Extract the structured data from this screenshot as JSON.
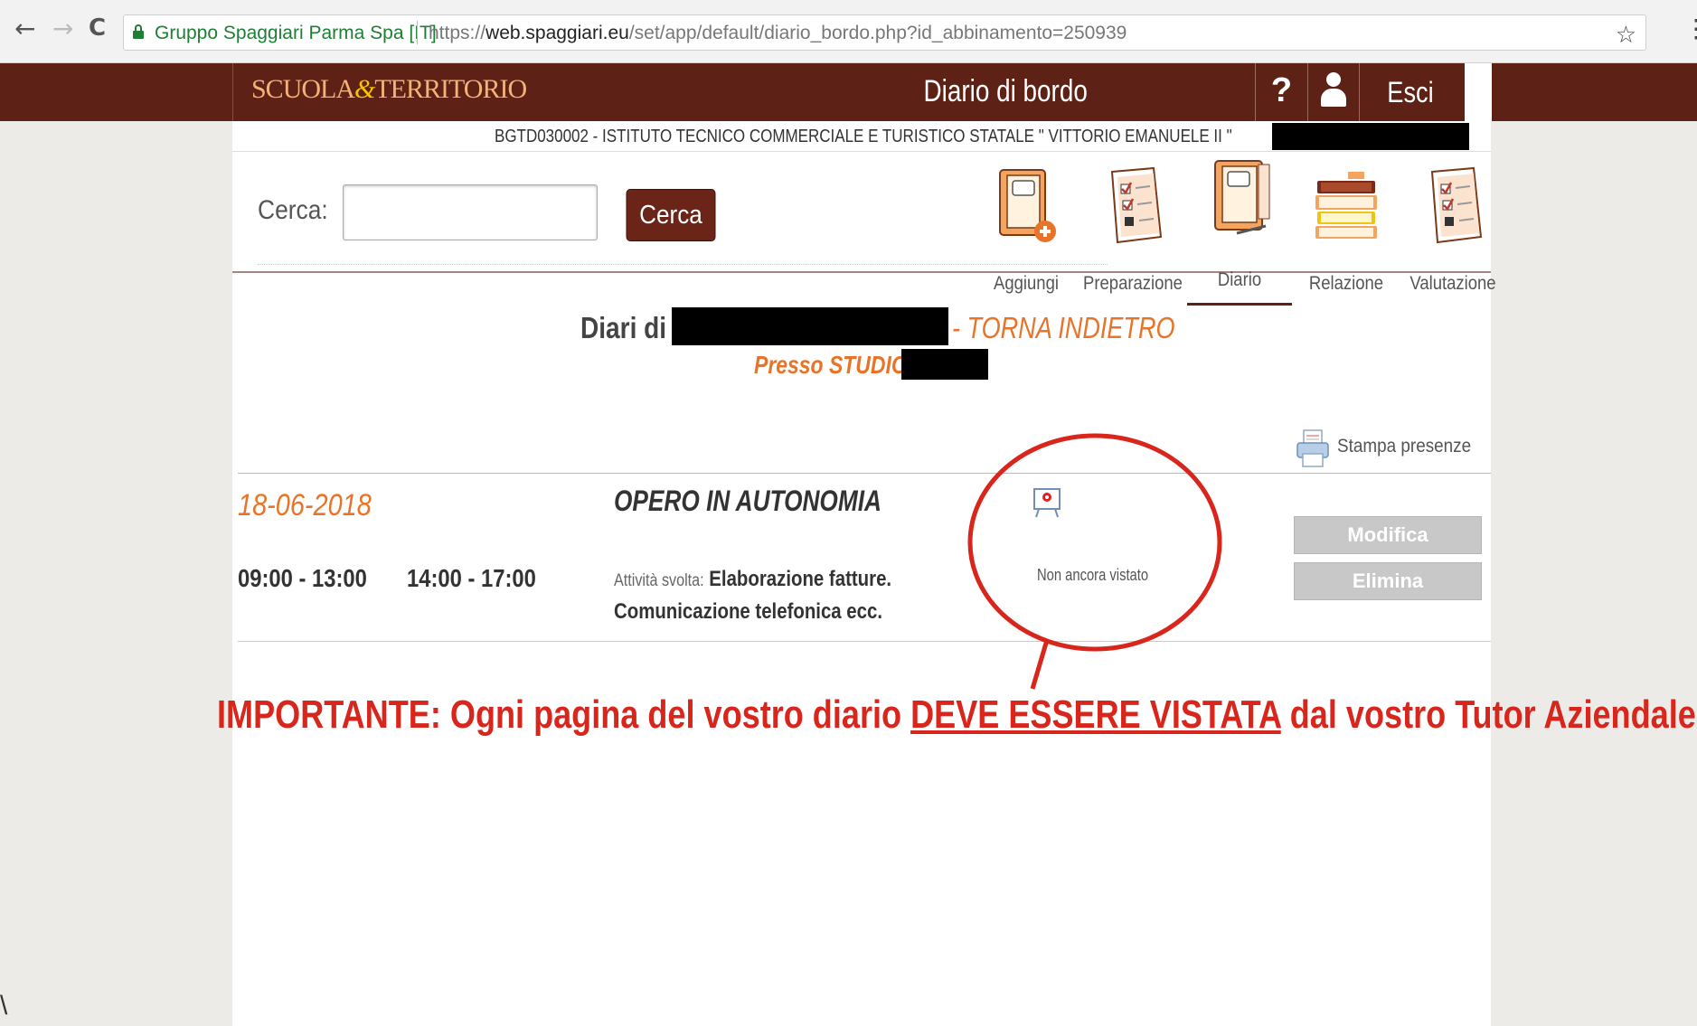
{
  "browser": {
    "back_icon": "←",
    "forward_icon": "→",
    "reload_icon": "C",
    "site_identity": "Gruppo Spaggiari Parma Spa [IT]",
    "url_prefix": "https://",
    "url_host": "web.spaggiari.eu",
    "url_path": "/set/app/default/diario_bordo.php?id_abbinamento=250939",
    "star_icon": "☆",
    "menu_icon": "⋮"
  },
  "header": {
    "logo": {
      "part1": "SCUOLA",
      "amp": "&",
      "part2": "TERRITORIO"
    },
    "title": "Diario di bordo",
    "help_label": "?",
    "logout_label": "Esci"
  },
  "school": {
    "name": "BGTD030002 - ISTITUTO TECNICO COMMERCIALE E TURISTICO STATALE \" VITTORIO EMANUELE II \""
  },
  "search": {
    "label": "Cerca:",
    "value": "",
    "placeholder": "",
    "button_label": "Cerca"
  },
  "toolbar": {
    "items": [
      {
        "label": "Aggiungi",
        "icon": "notebook-plus-icon"
      },
      {
        "label": "Preparazione",
        "icon": "checklist-icon"
      },
      {
        "label": "Diario",
        "icon": "notebook-icon",
        "active": true
      },
      {
        "label": "Relazione",
        "icon": "books-icon"
      },
      {
        "label": "Valutazione",
        "icon": "checklist-icon"
      }
    ]
  },
  "page": {
    "diari_label": "Diari di",
    "back_link": "- TORNA INDIETRO",
    "presso_label": "Presso STUDIO",
    "print_label": "Stampa presenze"
  },
  "entry": {
    "date": "18-06-2018",
    "time_morning": "09:00 - 13:00",
    "time_afternoon": "14:00 - 17:00",
    "title": "OPERO IN AUTONOMIA",
    "activity_prefix": "Attività svolta:",
    "activity_text": "Elaborazione fatture. Comunicazione telefonica ecc.",
    "status": "Non ancora vistato",
    "edit_label": "Modifica",
    "delete_label": "Elimina"
  },
  "annotation": {
    "text_before": "IMPORTANTE: Ogni pagina del vostro diario ",
    "text_underlined": "DEVE ESSERE VISTATA",
    "text_after": " dal vostro Tutor Aziendale",
    "color": "#d9261c"
  },
  "colors": {
    "brand_brown": "#5e2116",
    "accent_orange": "#e8742a",
    "button_gray": "#c8c8c8"
  }
}
